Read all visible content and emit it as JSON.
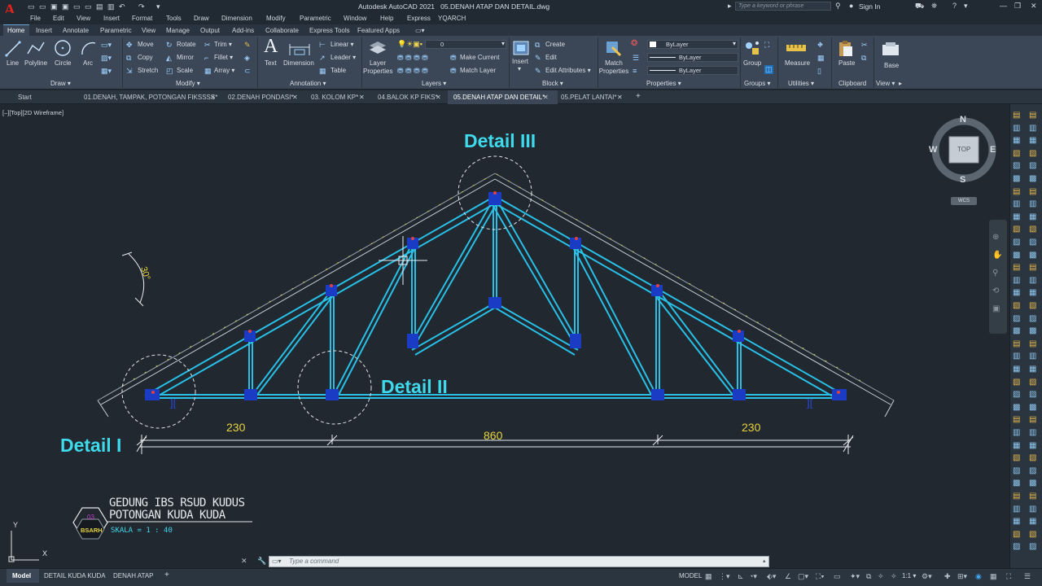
{
  "window": {
    "app_title": "Autodesk AutoCAD 2021",
    "file_title": "05.DENAH ATAP DAN DETAIL.dwg",
    "search_placeholder": "Type a keyword or phrase",
    "sign_in": "Sign In"
  },
  "menu": [
    "File",
    "Edit",
    "View",
    "Insert",
    "Format",
    "Tools",
    "Draw",
    "Dimension",
    "Modify",
    "Parametric",
    "Window",
    "Help",
    "Express",
    "YQARCH"
  ],
  "ribbon_tabs": [
    "Home",
    "Insert",
    "Annotate",
    "Parametric",
    "View",
    "Manage",
    "Output",
    "Add-ins",
    "Collaborate",
    "Express Tools",
    "Featured Apps"
  ],
  "ribbon": {
    "draw": {
      "title": "Draw",
      "tools": [
        "Line",
        "Polyline",
        "Circle",
        "Arc"
      ]
    },
    "modify": {
      "title": "Modify",
      "tools": [
        "Move",
        "Rotate",
        "Trim",
        "Copy",
        "Mirror",
        "Fillet",
        "Stretch",
        "Scale",
        "Array"
      ]
    },
    "annotation": {
      "title": "Annotation",
      "tools": [
        "Text",
        "Dimension",
        "Linear",
        "Leader",
        "Table"
      ]
    },
    "layers": {
      "title": "Layers",
      "layer_properties": "Layer Properties",
      "current_layer": "0",
      "make_current": "Make Current",
      "match_layer": "Match Layer"
    },
    "block": {
      "title": "Block",
      "insert": "Insert",
      "create": "Create",
      "edit": "Edit",
      "edit_attributes": "Edit Attributes"
    },
    "properties": {
      "title": "Properties",
      "match": "Match Properties",
      "color": "ByLayer",
      "linetype": "ByLayer",
      "lineweight": "ByLayer"
    },
    "groups": {
      "title": "Groups",
      "group": "Group"
    },
    "utilities": {
      "title": "Utilities",
      "measure": "Measure"
    },
    "clipboard": {
      "title": "Clipboard",
      "paste": "Paste"
    },
    "view": {
      "title": "View",
      "base": "Base"
    }
  },
  "file_tabs": [
    "Start",
    "01.DENAH, TAMPAK, POTONGAN FIKSSSS*",
    "02.DENAH PONDASI*",
    "03. KOLOM KP*",
    "04.BALOK KP FIKS*",
    "05.DENAH ATAP DAN DETAIL*",
    "05.PELAT LANTAI*"
  ],
  "viewport_label": "[–][Top][2D Wireframe]",
  "viewcube": {
    "n": "N",
    "s": "S",
    "e": "E",
    "w": "W",
    "top": "TOP",
    "wcs": "WCS"
  },
  "drawing": {
    "detail_1": "Detail I",
    "detail_2": "Detail II",
    "detail_3": "Detail III",
    "angle": "30°",
    "dim_left": "230",
    "dim_mid": "860",
    "dim_right": "230",
    "title_line1": "GEDUNG IBS RSUD KUDUS",
    "title_line2": "POTONGAN KUDA KUDA",
    "scale": "SKALA = 1 : 40",
    "stamp_number": "03",
    "stamp_code": "BSARH"
  },
  "ucs": {
    "x": "X",
    "y": "Y"
  },
  "command": {
    "placeholder": "Type  a  command"
  },
  "layout_tabs": [
    "Model",
    "DETAIL KUDA KUDA",
    "DENAH ATAP"
  ],
  "status": {
    "mode": "MODEL",
    "scale": "1:1"
  }
}
